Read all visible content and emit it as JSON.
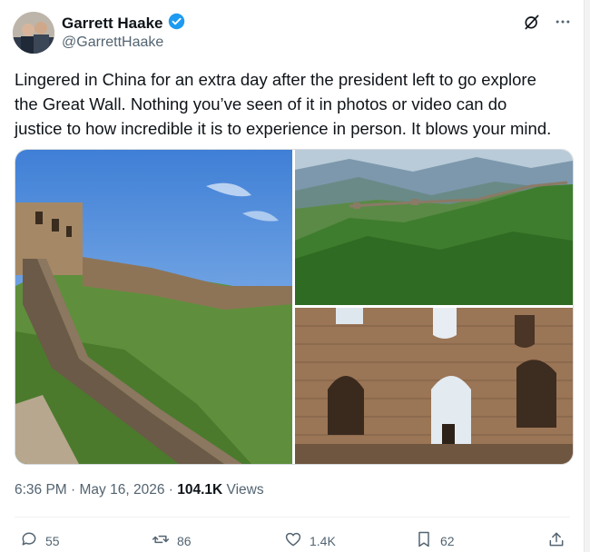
{
  "user": {
    "name": "Garrett Haake",
    "handle": "@GarrettHaake"
  },
  "icons": {
    "verified": "verified-badge-icon",
    "grok": "slash-circle-icon",
    "more": "more-dots-icon"
  },
  "tweet": {
    "text": "Lingered in China for an extra day after the president left to go explore the Great Wall. Nothing you’ve seen of it in photos or video can do justice to how incredible it is to experience in person. It blows your mind.",
    "line1": "Lingered in China for an extra day after the president left to go explore",
    "line2": "the Great Wall. Nothing you’ve seen of it in photos or video can do",
    "line3": "justice to how incredible it is to experience in person. It blows your mind."
  },
  "meta": {
    "time": "6:36 PM",
    "sep1": " · ",
    "date": "May 16, 2026",
    "sep2": " · ",
    "views_count": "104.1K",
    "views_label": " Views"
  },
  "actions": {
    "replies": "55",
    "reposts": "86",
    "likes": "1.4K",
    "bookmarks": "62"
  },
  "colors": {
    "accent": "#1d9bf0",
    "muted": "#536471",
    "text": "#0f1419"
  }
}
